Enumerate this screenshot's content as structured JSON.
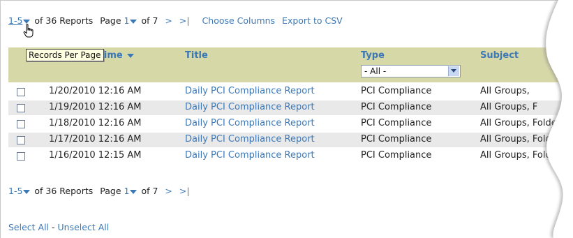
{
  "pager_top": {
    "range": "1-5",
    "of_reports": "of 36 Reports",
    "page_label": "Page",
    "page_current": "1",
    "of_pages": "of 7",
    "next": ">",
    "last": ">|",
    "choose_columns": "Choose Columns",
    "export_csv": "Export to CSV"
  },
  "tooltip": "Records Per Page",
  "table": {
    "headers": {
      "date_time": "Time",
      "title": "Title",
      "type": "Type",
      "subject": "Subject"
    },
    "type_filter": {
      "selected": "- All -"
    },
    "rows": [
      {
        "date": "1/20/2010 12:16 AM",
        "title": "Daily PCI Compliance Report",
        "type": "PCI Compliance",
        "subject": "All Groups,"
      },
      {
        "date": "1/19/2010 12:16 AM",
        "title": "Daily PCI Compliance Report",
        "type": "PCI Compliance",
        "subject": "All Groups, F"
      },
      {
        "date": "1/18/2010 12:16 AM",
        "title": "Daily PCI Compliance Report",
        "type": "PCI Compliance",
        "subject": "All Groups, Folde"
      },
      {
        "date": "1/17/2010 12:16 AM",
        "title": "Daily PCI Compliance Report",
        "type": "PCI Compliance",
        "subject": "All Groups, Folde"
      },
      {
        "date": "1/16/2010 12:15 AM",
        "title": "Daily PCI Compliance Report",
        "type": "PCI Compliance",
        "subject": "All Groups, Fold"
      }
    ]
  },
  "pager_bottom": {
    "range": "1-5",
    "of_reports": "of 36 Reports",
    "page_label": "Page",
    "page_current": "1",
    "of_pages": "of 7",
    "next": ">",
    "last": ">|"
  },
  "footer": {
    "select_all": "Select All",
    "separator": " - ",
    "unselect_all": "Unselect All"
  },
  "colors": {
    "link": "#3b78b8",
    "header_bg": "#d7d8a8",
    "alt_row": "#e9e9e9"
  }
}
